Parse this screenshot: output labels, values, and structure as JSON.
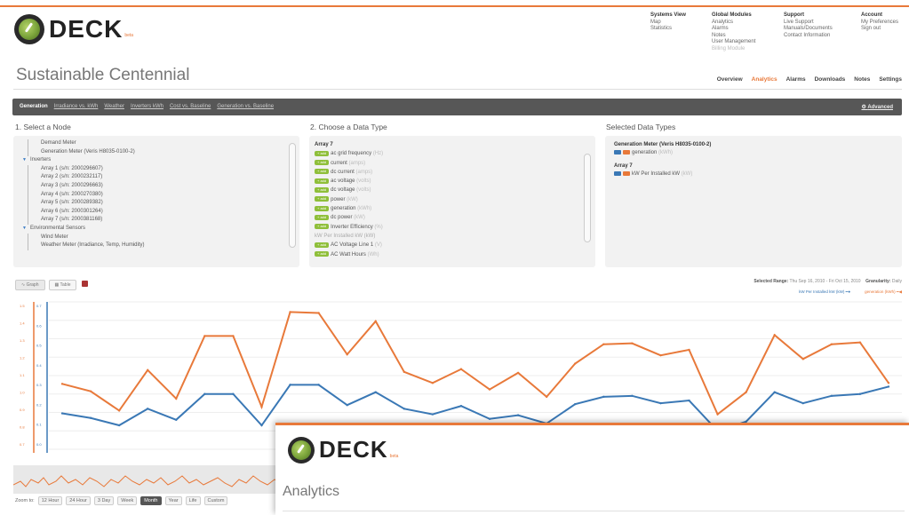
{
  "brand": {
    "name": "DECK",
    "beta": "beta"
  },
  "topnav": [
    {
      "heading": "Systems View",
      "items": [
        "Map",
        "Statistics"
      ]
    },
    {
      "heading": "Global Modules",
      "items": [
        "Analytics",
        "Alarms",
        "Notes",
        "User Management"
      ],
      "disabled": "Billing Module"
    },
    {
      "heading": "Support",
      "items": [
        "Live Support",
        "Manuals/Documents",
        "Contact Information"
      ]
    },
    {
      "heading": "Account",
      "items": [
        "My Preferences",
        "Sign out"
      ]
    }
  ],
  "page_title": "Sustainable Centennial",
  "subtabs": [
    "Overview",
    "Analytics",
    "Alarms",
    "Downloads",
    "Notes",
    "Settings"
  ],
  "analysis_tabs": [
    "Generation",
    "Irradiance vs. kWh",
    "Weather",
    "Inverters kWh",
    "Cost vs. Baseline",
    "Generation vs. Baseline"
  ],
  "advanced": "Advanced",
  "sections": {
    "node": "1. Select a Node",
    "data_type": "2. Choose a Data Type",
    "selected": "Selected Data Types"
  },
  "tree": {
    "demand": "Demand Meter",
    "generation": "Generation Meter (Veris H8035-0100-2)",
    "inverters": "Inverters",
    "arrays": [
      "Array 1 (s/n: 2000296607)",
      "Array 2 (s/n: 2000232117)",
      "Array 3 (s/n: 2000296663)",
      "Array 4 (s/n: 2000270380)",
      "Array 5 (s/n: 2000289382)",
      "Array 6 (s/n: 2000301264)",
      "Array 7 (s/n: 2000381168)"
    ],
    "env": "Environmental Sensors",
    "wind": "Wind Meter",
    "weather": "Weather Meter (Irradiance, Temp, Humidity)"
  },
  "data_types": {
    "heading": "Array 7",
    "add_label": "+ add",
    "items": [
      {
        "name": "ac grid frequency",
        "unit": "(Hz)"
      },
      {
        "name": "current",
        "unit": "(amps)"
      },
      {
        "name": "dc current",
        "unit": "(amps)"
      },
      {
        "name": "ac voltage",
        "unit": "(volts)"
      },
      {
        "name": "dc voltage",
        "unit": "(volts)"
      },
      {
        "name": "power",
        "unit": "(kW)"
      },
      {
        "name": "generation",
        "unit": "(kWh)"
      },
      {
        "name": "dc power",
        "unit": "(kW)"
      },
      {
        "name": "Inverter Efficiency",
        "unit": "(%)"
      }
    ],
    "plain": "kW Per Installed kW (kW)",
    "more": [
      {
        "name": "AC Voltage Line 1",
        "unit": "(V)"
      },
      {
        "name": "AC Watt Hours",
        "unit": "(Wh)"
      }
    ]
  },
  "selected": {
    "groups": [
      {
        "heading": "Generation Meter (Veris H8035-0100-2)",
        "item": "generation",
        "unit": "(kWh)"
      },
      {
        "heading": "Array 7",
        "item": "kW Per Installed kW",
        "unit": "(kW)"
      }
    ]
  },
  "graph_tabs": {
    "graph": "Graph",
    "table": "Table"
  },
  "selected_range_label": "Selected Range:",
  "selected_range": "Thu Sep 16, 2010 - Fri Oct 15, 2010",
  "granularity_label": "Granularity:",
  "granularity": "Daily",
  "zoom": {
    "label": "Zoom to:",
    "options": [
      "12 Hour",
      "24 Hour",
      "3 Day",
      "Week",
      "Month",
      "Year",
      "Life",
      "Custom"
    ],
    "active": "Month"
  },
  "overlay": {
    "title": "Analytics"
  },
  "colors": {
    "accent": "#e8793a",
    "series_blue": "#3a78b5",
    "add_green": "#8fbf3a"
  },
  "chart_data": {
    "type": "line",
    "series": [
      {
        "name": "kW Per Installed kW (kW)",
        "color": "#3a78b5",
        "values": [
          0.39,
          0.34,
          0.26,
          0.44,
          0.32,
          0.6,
          0.6,
          0.26,
          0.7,
          0.7,
          0.48,
          0.62,
          0.44,
          0.38,
          0.47,
          0.33,
          0.37,
          0.28,
          0.49,
          0.57,
          0.58,
          0.5,
          0.53,
          0.2,
          0.3,
          0.62,
          0.5,
          0.58,
          0.6,
          0.68
        ]
      },
      {
        "name": "generation (kWh)",
        "color": "#e8793a",
        "values": [
          0.71,
          0.63,
          0.42,
          0.86,
          0.55,
          1.23,
          1.23,
          0.46,
          1.49,
          1.48,
          1.03,
          1.39,
          0.84,
          0.72,
          0.87,
          0.65,
          0.83,
          0.57,
          0.93,
          1.14,
          1.15,
          1.02,
          1.08,
          0.38,
          0.62,
          1.24,
          0.98,
          1.14,
          1.16,
          0.72
        ]
      }
    ],
    "left_axis_ticks": [
      "1.5",
      "1.4",
      "1.3",
      "1.2",
      "1.1",
      "1.0",
      "0.9",
      "0.8",
      "0.7"
    ],
    "right_axis_ticks": [
      "0.7",
      "0.6",
      "0.5",
      "0.4",
      "0.3",
      "0.2",
      "0.1",
      "0.0"
    ],
    "ylim": [
      0,
      1.6
    ]
  }
}
